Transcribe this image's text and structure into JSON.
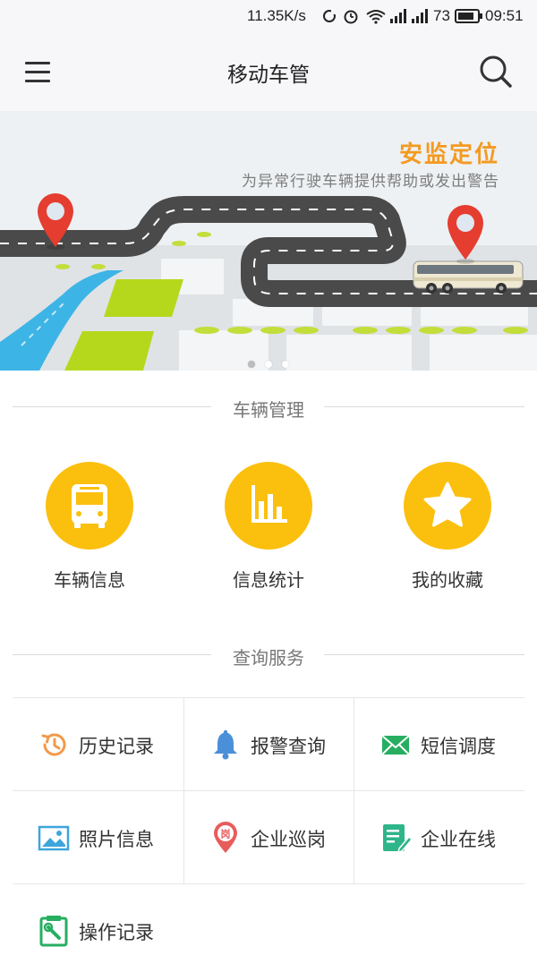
{
  "status_bar": {
    "speed": "11.35K/s",
    "battery": "73",
    "time": "09:51"
  },
  "app_bar": {
    "title": "移动车管",
    "menu_icon": "hamburger-menu-icon",
    "search_icon": "search-icon"
  },
  "banner": {
    "title": "安监定位",
    "subtitle": "为异常行驶车辆提供帮助或发出警告",
    "slides_total": 3,
    "active_slide": 1
  },
  "vehicle_section": {
    "header": "车辆管理",
    "items": [
      {
        "label": "车辆信息",
        "icon": "bus-icon"
      },
      {
        "label": "信息统计",
        "icon": "bar-chart-icon"
      },
      {
        "label": "我的收藏",
        "icon": "star-icon"
      }
    ]
  },
  "query_section": {
    "header": "查询服务",
    "items": [
      {
        "label": "历史记录",
        "icon": "history-clock-icon",
        "color": "#f2994a"
      },
      {
        "label": "报警查询",
        "icon": "alarm-bell-icon",
        "color": "#4a90d9"
      },
      {
        "label": "短信调度",
        "icon": "envelope-icon",
        "color": "#27ae60"
      },
      {
        "label": "照片信息",
        "icon": "photo-icon",
        "color": "#3da5dc"
      },
      {
        "label": "企业巡岗",
        "icon": "patrol-pin-icon",
        "color": "#e85c5c"
      },
      {
        "label": "企业在线",
        "icon": "online-doc-icon",
        "color": "#2eb58a"
      },
      {
        "label": "操作记录",
        "icon": "operation-log-icon",
        "color": "#27ae60"
      }
    ]
  },
  "colors": {
    "accent": "#fbbf0e",
    "banner_title": "#f39a21"
  }
}
